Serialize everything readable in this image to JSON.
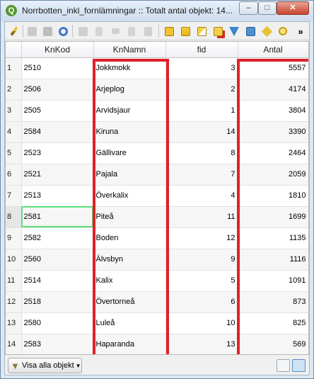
{
  "window": {
    "title": "Norrbotten_inkl_fornlämningar :: Totalt antal objekt: 14...",
    "app_icon": "Q",
    "accent": "#589632"
  },
  "toolbar": {
    "icons": [
      "edit-pencil-icon",
      "multi-edit-icon",
      "save-icon",
      "refresh-icon",
      "add-feature-icon",
      "delete-icon",
      "cut-icon",
      "copy-icon",
      "paste-icon",
      "expression-select-icon",
      "select-all-icon",
      "invert-selection-icon",
      "deselect-icon",
      "filter-icon",
      "move-to-top-icon",
      "pan-to-icon",
      "zoom-to-icon"
    ],
    "overflow": "»"
  },
  "table": {
    "columns": [
      "KnKod",
      "KnNamn",
      "fid",
      "Antal"
    ],
    "rows": [
      {
        "n": "1",
        "kod": "2510",
        "namn": "Jokkmokk",
        "fid": "3",
        "antal": "5557"
      },
      {
        "n": "2",
        "kod": "2506",
        "namn": "Arjeplog",
        "fid": "2",
        "antal": "4174"
      },
      {
        "n": "3",
        "kod": "2505",
        "namn": "Arvidsjaur",
        "fid": "1",
        "antal": "3804"
      },
      {
        "n": "4",
        "kod": "2584",
        "namn": "Kiruna",
        "fid": "14",
        "antal": "3390"
      },
      {
        "n": "5",
        "kod": "2523",
        "namn": "Gällivare",
        "fid": "8",
        "antal": "2464"
      },
      {
        "n": "6",
        "kod": "2521",
        "namn": "Pajala",
        "fid": "7",
        "antal": "2059"
      },
      {
        "n": "7",
        "kod": "2513",
        "namn": "Överkalix",
        "fid": "4",
        "antal": "1810"
      },
      {
        "n": "8",
        "kod": "2581",
        "namn": "Piteå",
        "fid": "11",
        "antal": "1699"
      },
      {
        "n": "9",
        "kod": "2582",
        "namn": "Boden",
        "fid": "12",
        "antal": "1135"
      },
      {
        "n": "10",
        "kod": "2560",
        "namn": "Älvsbyn",
        "fid": "9",
        "antal": "1116"
      },
      {
        "n": "11",
        "kod": "2514",
        "namn": "Kalix",
        "fid": "5",
        "antal": "1091"
      },
      {
        "n": "12",
        "kod": "2518",
        "namn": "Övertorneå",
        "fid": "6",
        "antal": "873"
      },
      {
        "n": "13",
        "kod": "2580",
        "namn": "Luleå",
        "fid": "10",
        "antal": "825"
      },
      {
        "n": "14",
        "kod": "2583",
        "namn": "Haparanda",
        "fid": "13",
        "antal": "569"
      }
    ],
    "current_row": 8,
    "highlight_color": "#e0202a"
  },
  "bottom": {
    "show_all_label": "Visa alla objekt",
    "view_buttons": [
      "form-view-icon",
      "table-view-icon"
    ]
  }
}
